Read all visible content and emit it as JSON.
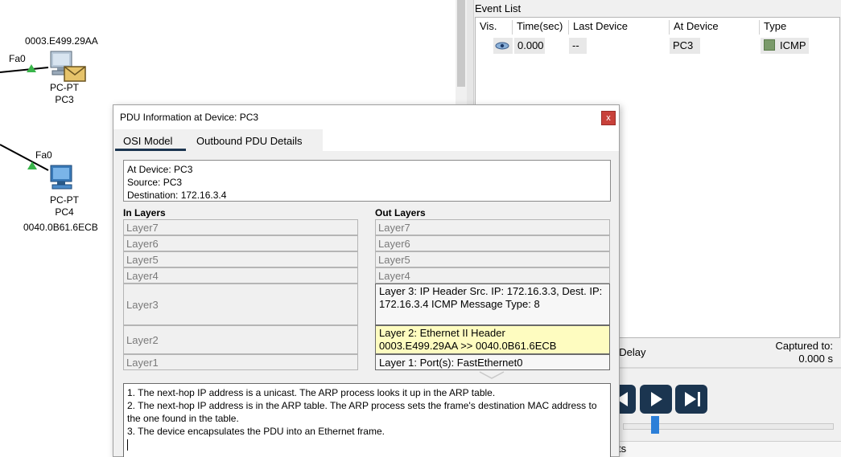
{
  "topology": {
    "pc3": {
      "mac": "0003.E499.29AA",
      "interface": "Fa0",
      "type": "PC-PT",
      "name": "PC3"
    },
    "pc4": {
      "mac": "0040.0B61.6ECB",
      "interface": "Fa0",
      "type": "PC-PT",
      "name": "PC4"
    },
    "pdu_icon": "envelope-icon"
  },
  "event_list": {
    "title": "Event List",
    "columns": [
      "Vis.",
      "Time(sec)",
      "Last Device",
      "At Device",
      "Type"
    ],
    "rows": [
      {
        "vis_icon": "eye-icon",
        "time": "0.000",
        "last_device": "--",
        "at_device": "PC3",
        "type": "ICMP",
        "type_color": "#7a9a6a"
      }
    ]
  },
  "simulation": {
    "delay_label_partial": "t Delay",
    "captured_label": "Captured to:",
    "captured_value": "0.000 s",
    "bottom_text_partial": "ts",
    "controls": [
      "step-back-icon",
      "play-icon",
      "step-forward-icon"
    ],
    "speed_slider_fraction": 0.14
  },
  "dialog": {
    "title": "PDU Information at Device: PC3",
    "close_label": "x",
    "tabs": [
      "OSI Model",
      "Outbound PDU Details"
    ],
    "active_tab": "OSI Model",
    "info": {
      "at_device": "At Device: PC3",
      "source": "Source: PC3",
      "destination": "Destination: 172.16.3.4"
    },
    "in_layers_title": "In Layers",
    "out_layers_title": "Out Layers",
    "in_layers": [
      "Layer7",
      "Layer6",
      "Layer5",
      "Layer4",
      "Layer3",
      "Layer2",
      "Layer1"
    ],
    "out_layers": {
      "layer7": "Layer7",
      "layer6": "Layer6",
      "layer5": "Layer5",
      "layer4": "Layer4",
      "layer3": "Layer 3: IP Header Src. IP: 172.16.3.3, Dest. IP: 172.16.3.4 ICMP Message Type: 8",
      "layer2_line1": "Layer 2: Ethernet II Header",
      "layer2_line2": "0003.E499.29AA >> 0040.0B61.6ECB",
      "layer1": "Layer 1: Port(s): FastEthernet0"
    },
    "description": [
      "1. The next-hop IP address is a unicast. The ARP process looks it up in the ARP table.",
      "2. The next-hop IP address is in the ARP table. The ARP process sets the frame's destination MAC address to the one found in the table.",
      "3. The device encapsulates the PDU into an Ethernet frame."
    ]
  }
}
